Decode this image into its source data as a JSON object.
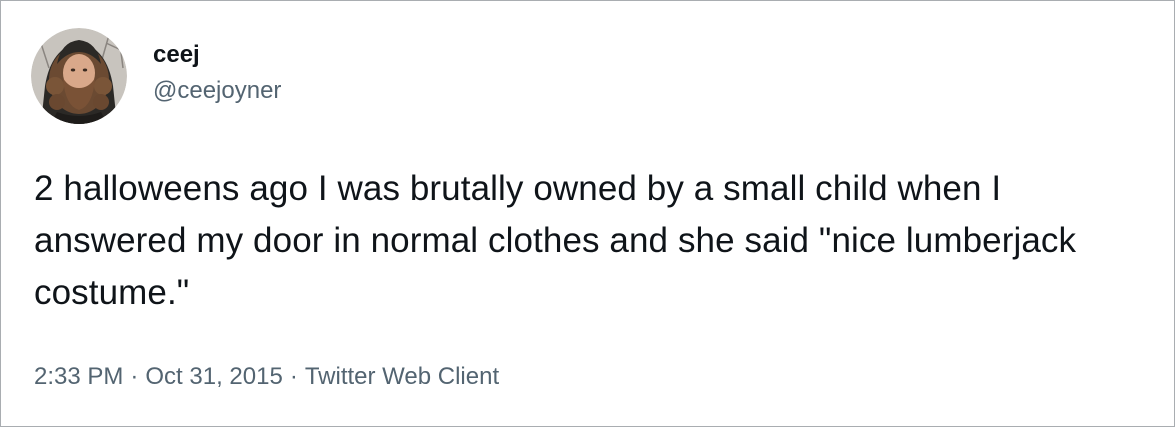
{
  "tweet": {
    "author": {
      "display_name": "ceej",
      "handle": "@ceejoyner"
    },
    "text": "2 halloweens ago I was brutally owned by a small child when I answered my door in normal clothes and she said \"nice lumberjack costume.\"",
    "meta": {
      "time": "2:33 PM",
      "separator": "·",
      "date": "Oct 31, 2015",
      "source": "Twitter Web Client"
    }
  },
  "colors": {
    "text_primary": "#0f1419",
    "text_secondary": "#536471",
    "border": "#a9adb1"
  }
}
